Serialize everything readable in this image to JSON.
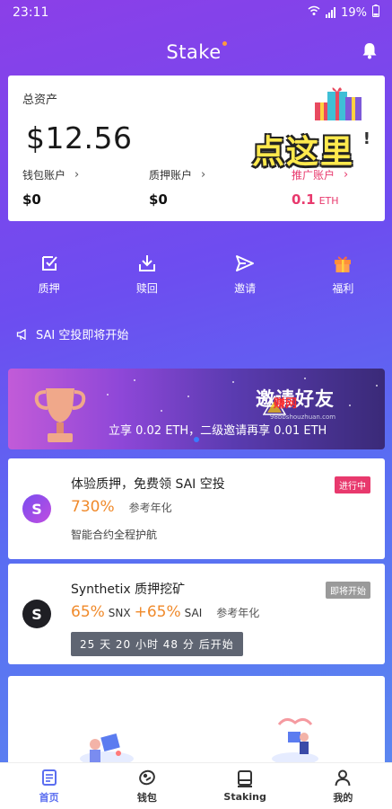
{
  "status_bar": {
    "time": "23:11",
    "battery": "19%"
  },
  "header": {
    "title": "Stake"
  },
  "assets": {
    "title": "总资产",
    "total": "$12.56",
    "promo_overlay": "点这里",
    "wallet": {
      "label": "钱包账户",
      "value": "$0"
    },
    "staked": {
      "label": "质押账户",
      "value": "$0"
    },
    "promo": {
      "label": "推广账户",
      "value": "0.1",
      "unit": "ETH"
    }
  },
  "actions": [
    {
      "label": "质押",
      "icon": "stake-icon"
    },
    {
      "label": "赎回",
      "icon": "redeem-icon"
    },
    {
      "label": "邀请",
      "icon": "invite-icon"
    },
    {
      "label": "福利",
      "icon": "gift-icon"
    }
  ],
  "notice": {
    "text": "SAI 空投即将开始"
  },
  "banner": {
    "title": "邀请好友",
    "subtitle": "立享 0.02 ETH，二级邀请再享 0.01 ETH",
    "watermark": "赚网",
    "watermark_url": "98bbshouzhuan.com"
  },
  "pools": [
    {
      "name": "体验质押，免费领 SAI 空投",
      "badge": "进行中",
      "rate": "730%",
      "rate_ref": "参考年化",
      "note": "智能合约全程护航",
      "icon_letter": "S"
    },
    {
      "name": "Synthetix 质押挖矿",
      "badge": "即将开始",
      "rate_a": "65%",
      "token_a": "SNX",
      "rate_b": "+65%",
      "token_b": "SAI",
      "rate_ref": "参考年化",
      "countdown": "25 天 20 小时 48 分 后开始",
      "icon_letter": "S"
    }
  ],
  "tabbar": [
    {
      "label": "首页",
      "icon": "home-icon",
      "active": true
    },
    {
      "label": "钱包",
      "icon": "wallet-icon",
      "active": false
    },
    {
      "label": "Staking",
      "icon": "staking-icon",
      "active": false
    },
    {
      "label": "我的",
      "icon": "profile-icon",
      "active": false
    }
  ],
  "colors": {
    "accent": "#5b6ef0",
    "promo": "#e8396d",
    "rate": "#f08a2b",
    "badge_active": "#e8396d",
    "badge_upcoming": "#9a9a9a"
  }
}
